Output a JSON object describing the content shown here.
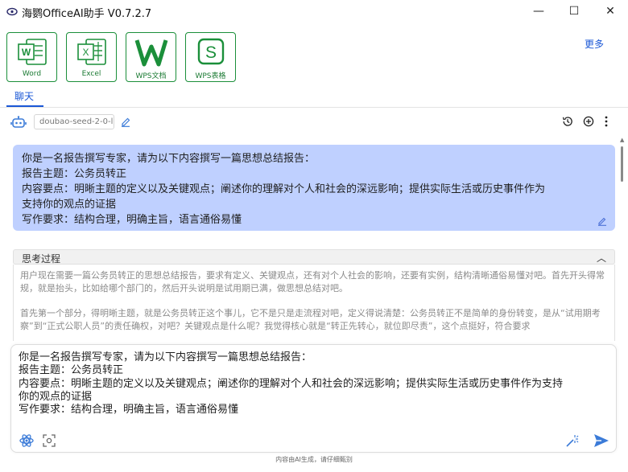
{
  "window": {
    "title": "海鹦OfficeAI助手 V0.7.2.7",
    "minimize_glyph": "—",
    "maximize_glyph": "☐",
    "close_glyph": "✕"
  },
  "apps": [
    {
      "label": "Word",
      "icon": "word-icon"
    },
    {
      "label": "Excel",
      "icon": "excel-icon"
    },
    {
      "label": "WPS文档",
      "icon": "wps-doc-icon"
    },
    {
      "label": "WPS表格",
      "icon": "wps-sheet-icon"
    }
  ],
  "more_label": "更多",
  "tabs": [
    {
      "label": "聊天",
      "active": true
    }
  ],
  "model": {
    "value": "doubao-seed-2-0-l"
  },
  "messages": {
    "user_lines": [
      "你是一名报告撰写专家，请为以下内容撰写一篇思想总结报告：",
      "报告主题：公务员转正",
      "内容要点：明晰主题的定义以及关键观点；阐述你的理解对个人和社会的深远影响；提供实际生活或历史事件作为",
      "支持你的观点的证据",
      "写作要求：结构合理，明确主旨，语言通俗易懂"
    ],
    "thinking_title": "思考过程",
    "thinking_toggle": "︿",
    "thinking_paragraphs": [
      "用户现在需要一篇公务员转正的思想总结报告，要求有定义、关键观点，还有对个人社会的影响，还要有实例，结构清晰通俗易懂对吧。首先开头得常规，就是抬头，比如给哪个部门的，然后开头说明是试用期已满，做思想总结对吧。",
      "首先第一个部分，得明晰主题，就是公务员转正这个事儿，它不是只是走流程对吧，定义得说清楚：公务员转正不是简单的身份转变，是从“试用期考察”到“正式公职人员”的责任确权，对吧？关键观点是什么呢？我觉得核心就是“转正先转心，就位即尽责”，这个点挺好，符合要求"
    ]
  },
  "input": {
    "lines": [
      "你是一名报告撰写专家，请为以下内容撰写一篇思想总结报告：",
      "报告主题：公务员转正",
      "内容要点：明晰主题的定义以及关键观点；阐述你的理解对个人和社会的深远影响；提供实际生活或历史事件作为支持",
      "你的观点的证据",
      "写作要求：结构合理，明确主旨，语言通俗易懂"
    ]
  },
  "footer": "内容由AI生成，请仔细甄别",
  "colors": {
    "accent": "#1a57d6",
    "app_green": "#1b8f3a",
    "user_bubble": "#bfd0ff"
  }
}
